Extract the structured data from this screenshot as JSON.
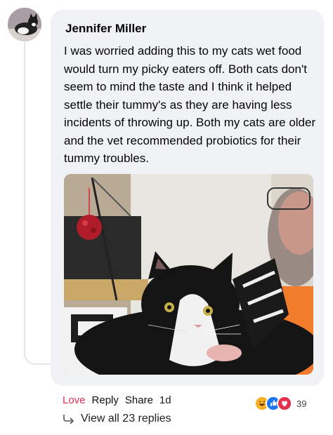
{
  "comment": {
    "author": "Jennifer Miller",
    "text": "I was worried adding this to my cats wet food would turn my picky eaters off. Both cats don't seem to mind the taste and I think it helped settle their tummy's as they are having less incidents of throwing up. Both my cats are older and the vet recommended probiotics for their tummy troubles.",
    "avatar_icon": "cat-avatar",
    "photo_icon": "cat-photo"
  },
  "actions": {
    "love_label": "Love",
    "reply_label": "Reply",
    "share_label": "Share",
    "time": "1d"
  },
  "reactions": {
    "icons": [
      "haha-icon",
      "like-icon",
      "love-icon"
    ],
    "count": "39"
  },
  "replies": {
    "label": "View all 23 replies"
  },
  "colors": {
    "love": "#e4324e",
    "like": "#1877f2",
    "haha": "#f7b125",
    "bubble": "#f0f2f5"
  }
}
